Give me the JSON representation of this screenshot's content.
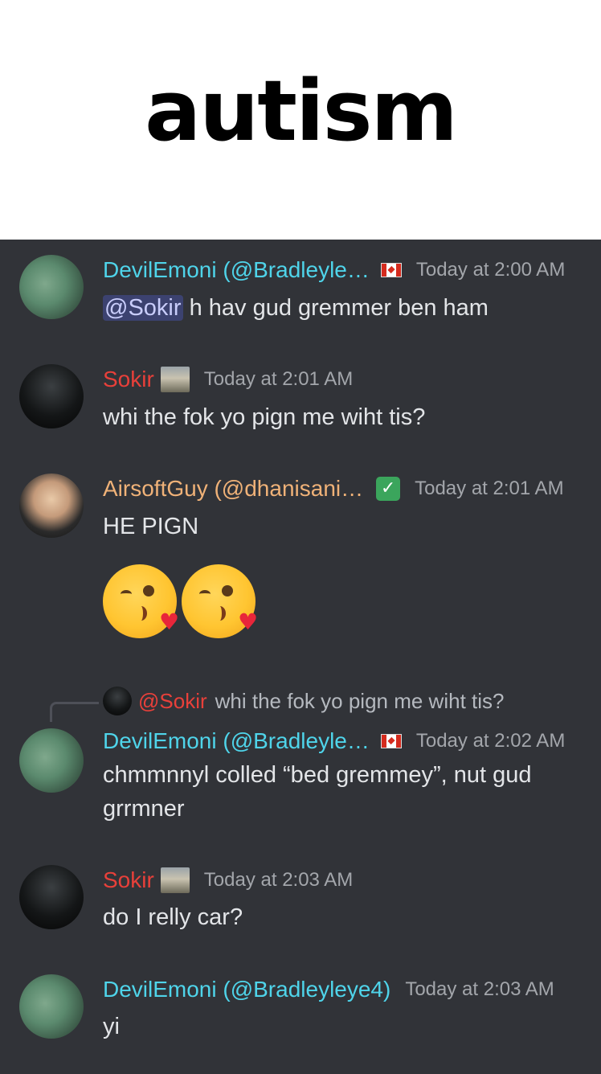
{
  "caption": {
    "text": "autism"
  },
  "messages": [
    {
      "username": "DevilEmoni (@Bradleyle…",
      "timestamp": "Today at 2:00 AM",
      "mention": "@Sokir",
      "text": "h hav gud gremmer ben ham"
    },
    {
      "username": "Sokir",
      "timestamp": "Today at 2:01 AM",
      "text": "whi the fok yo pign me wiht tis?"
    },
    {
      "username": "AirsoftGuy (@dhanisani…",
      "timestamp": "Today at 2:01 AM",
      "text": "HE PIGN",
      "emojis": [
        "kissing-heart",
        "kissing-heart"
      ]
    },
    {
      "reply": {
        "mention": "@Sokir",
        "text": "whi the fok yo pign me wiht tis?"
      },
      "username": "DevilEmoni (@Bradleyle…",
      "timestamp": "Today at 2:02 AM",
      "text": "chmmnnyl colled “bed gremmey”, nut gud grrmner"
    },
    {
      "username": "Sokir",
      "timestamp": "Today at 2:03 AM",
      "text": "do I relly car?"
    },
    {
      "username": "DevilEmoni (@Bradleyleye4)",
      "timestamp": "Today at 2:03 AM",
      "text": "yi"
    }
  ],
  "colors": {
    "background": "#313338",
    "devilemoni": "#4fd4ea",
    "sokir": "#e8403a",
    "airsoftguy": "#f0b278",
    "mention_bg": "#3c4270"
  },
  "icons": [
    "canada-flag-icon",
    "user-picture-badge-icon",
    "check-mark-badge-icon",
    "kissing-heart-emoji-icon"
  ]
}
